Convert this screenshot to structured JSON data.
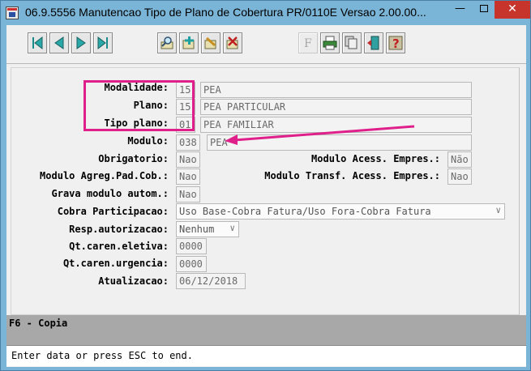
{
  "window": {
    "title": "06.9.5556 Manutencao  Tipo de Plano de Cobertura PR/0110E Versao 2.00.00...",
    "min_label": "—",
    "close_label": "✕"
  },
  "toolbar": {
    "buttons": [
      "first-record",
      "previous-record",
      "next-record",
      "last-record",
      "search",
      "add",
      "edit",
      "delete",
      "filter",
      "print",
      "copy",
      "exit",
      "help"
    ]
  },
  "form": {
    "modalidade": {
      "label": "Modalidade:",
      "code": "15",
      "desc": "PEA"
    },
    "plano": {
      "label": "Plano:",
      "code": "15",
      "desc": "PEA PARTICULAR"
    },
    "tipo_plano": {
      "label": "Tipo plano:",
      "code": "01",
      "desc": "PEA FAMILIAR"
    },
    "modulo": {
      "label": "Modulo:",
      "code": "038",
      "desc": "PEA"
    },
    "obrigatorio": {
      "label": "Obrigatorio:",
      "value": "Nao"
    },
    "modulo_acess_empres": {
      "label": "Modulo Acess. Empres.:",
      "value": "Não"
    },
    "modulo_agreg": {
      "label": "Modulo Agreg.Pad.Cob.:",
      "value": "Nao"
    },
    "modulo_transf": {
      "label": "Modulo Transf. Acess. Empres.:",
      "value": "Nao"
    },
    "grava_modulo": {
      "label": "Grava modulo autom.:",
      "value": "Nao"
    },
    "cobra_participacao": {
      "label": "Cobra Participacao:",
      "value": "Uso Base-Cobra Fatura/Uso Fora-Cobra Fatura"
    },
    "resp_autorizacao": {
      "label": "Resp.autorizacao:",
      "value": "Nenhum"
    },
    "qt_caren_eletiva": {
      "label": "Qt.caren.eletiva:",
      "value": "0000"
    },
    "qt_caren_urgencia": {
      "label": "Qt.caren.urgencia:",
      "value": "0000"
    },
    "atualizacao": {
      "label": "Atualizacao:",
      "value": "06/12/2018"
    }
  },
  "status": {
    "hint": "F6 - Copia"
  },
  "message": {
    "text": "Enter data or press ESC to end."
  },
  "colors": {
    "annotation": "#e0208a",
    "titlebar": "#7ab4d6",
    "close": "#c7342c"
  }
}
